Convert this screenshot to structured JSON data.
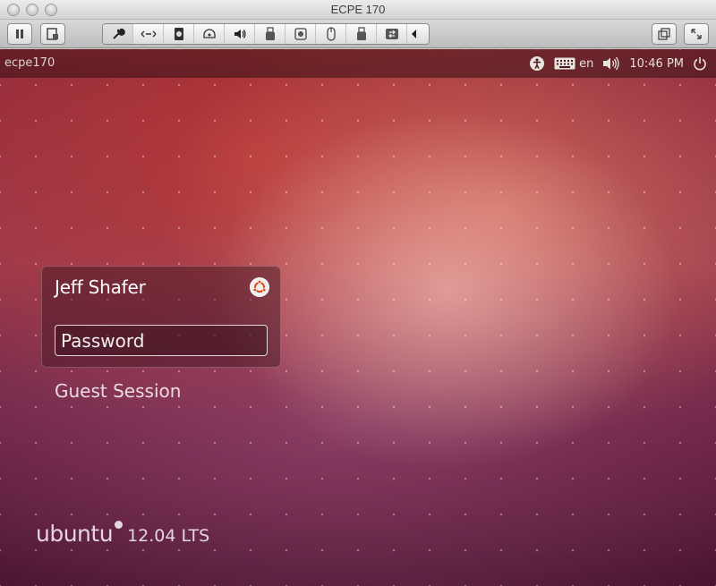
{
  "window": {
    "title": "ECPE 170"
  },
  "toolbar": {
    "left_buttons": [
      "pause-icon",
      "snapshot-icon"
    ],
    "device_icons": [
      "wrench-icon",
      "network-icon",
      "hard-disk-icon",
      "cd-drive-icon",
      "sound-icon",
      "usb-icon",
      "camera-icon",
      "mouse-icon",
      "printer-icon",
      "sync-icon",
      "collapse-arrow-icon"
    ],
    "right_buttons": [
      "unity-view-icon",
      "fullscreen-icon"
    ]
  },
  "panel": {
    "hostname": "ecpe170",
    "keyboard_layout": "en",
    "time": "10:46 PM"
  },
  "login": {
    "user_name": "Jeff Shafer",
    "password_placeholder": "Password",
    "guest_session": "Guest Session"
  },
  "branding": {
    "name": "ubuntu",
    "version": "12.04 LTS"
  },
  "colors": {
    "accent": "#dd4814",
    "panel_text": "#dfdbd2"
  }
}
